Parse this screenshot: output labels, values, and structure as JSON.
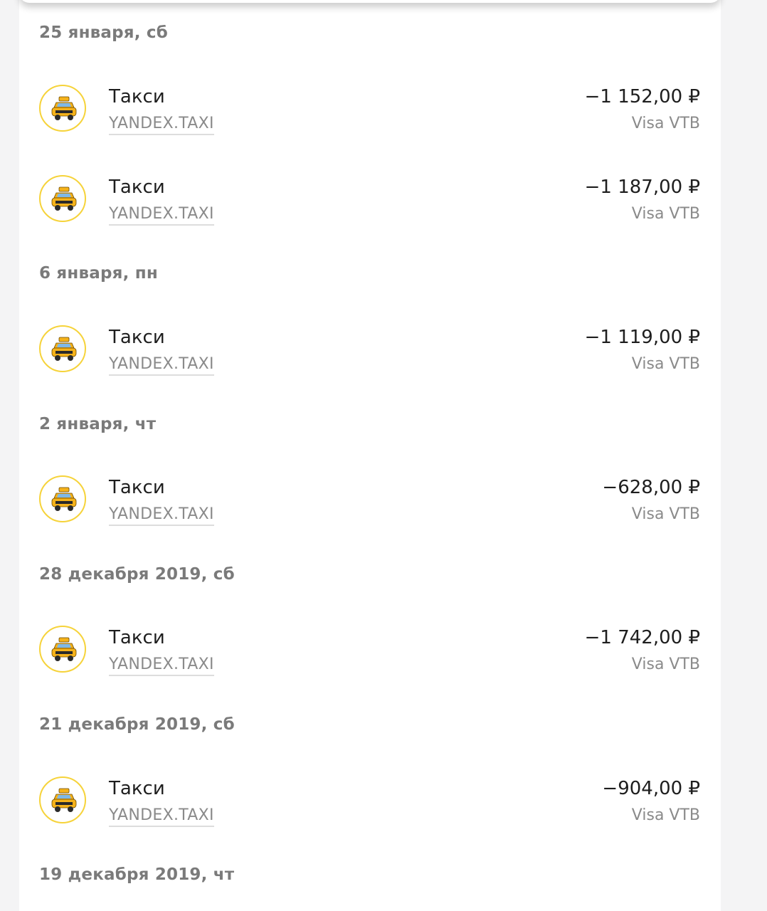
{
  "groups": [
    {
      "date": "25 января, сб",
      "transactions": [
        {
          "category": "Такси",
          "merchant": "YANDEX.TAXI",
          "amount": "−1 152,00 ₽",
          "card": "Visa VTB",
          "icon": "taxi-icon"
        },
        {
          "category": "Такси",
          "merchant": "YANDEX.TAXI",
          "amount": "−1 187,00 ₽",
          "card": "Visa VTB",
          "icon": "taxi-icon"
        }
      ]
    },
    {
      "date": "6 января, пн",
      "transactions": [
        {
          "category": "Такси",
          "merchant": "YANDEX.TAXI",
          "amount": "−1 119,00 ₽",
          "card": "Visa VTB",
          "icon": "taxi-icon"
        }
      ]
    },
    {
      "date": "2 января, чт",
      "transactions": [
        {
          "category": "Такси",
          "merchant": "YANDEX.TAXI",
          "amount": "−628,00 ₽",
          "card": "Visa VTB",
          "icon": "taxi-icon"
        }
      ]
    },
    {
      "date": "28 декабря 2019, сб",
      "transactions": [
        {
          "category": "Такси",
          "merchant": "YANDEX.TAXI",
          "amount": "−1 742,00 ₽",
          "card": "Visa VTB",
          "icon": "taxi-icon"
        }
      ]
    },
    {
      "date": "21 декабря 2019, сб",
      "transactions": [
        {
          "category": "Такси",
          "merchant": "YANDEX.TAXI",
          "amount": "−904,00 ₽",
          "card": "Visa VTB",
          "icon": "taxi-icon"
        }
      ]
    },
    {
      "date": "19 декабря 2019, чт",
      "transactions": []
    }
  ],
  "colors": {
    "icon_ring": "#f6d33a",
    "taxi_yellow": "#f5b21a",
    "amount_text": "#1e1e1e",
    "secondary_text": "#8a8a8a",
    "date_text": "#7a7a7a"
  }
}
